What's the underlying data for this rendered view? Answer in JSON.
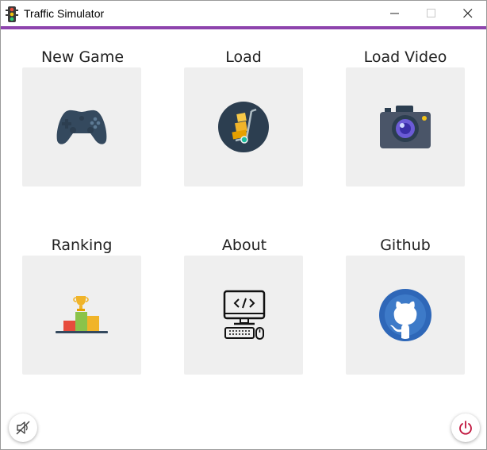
{
  "window": {
    "title": "Traffic Simulator",
    "accent_color": "#8e44ad"
  },
  "menu": {
    "items": [
      {
        "label": "New Game",
        "icon": "gamepad-icon"
      },
      {
        "label": "Load",
        "icon": "hand-truck-boxes-icon"
      },
      {
        "label": "Load Video",
        "icon": "camera-icon"
      },
      {
        "label": "Ranking",
        "icon": "podium-trophy-icon"
      },
      {
        "label": "About",
        "icon": "computer-code-icon"
      },
      {
        "label": "Github",
        "icon": "github-icon"
      }
    ]
  },
  "footer": {
    "mute_icon": "speaker-muted-icon",
    "power_icon": "power-icon"
  }
}
